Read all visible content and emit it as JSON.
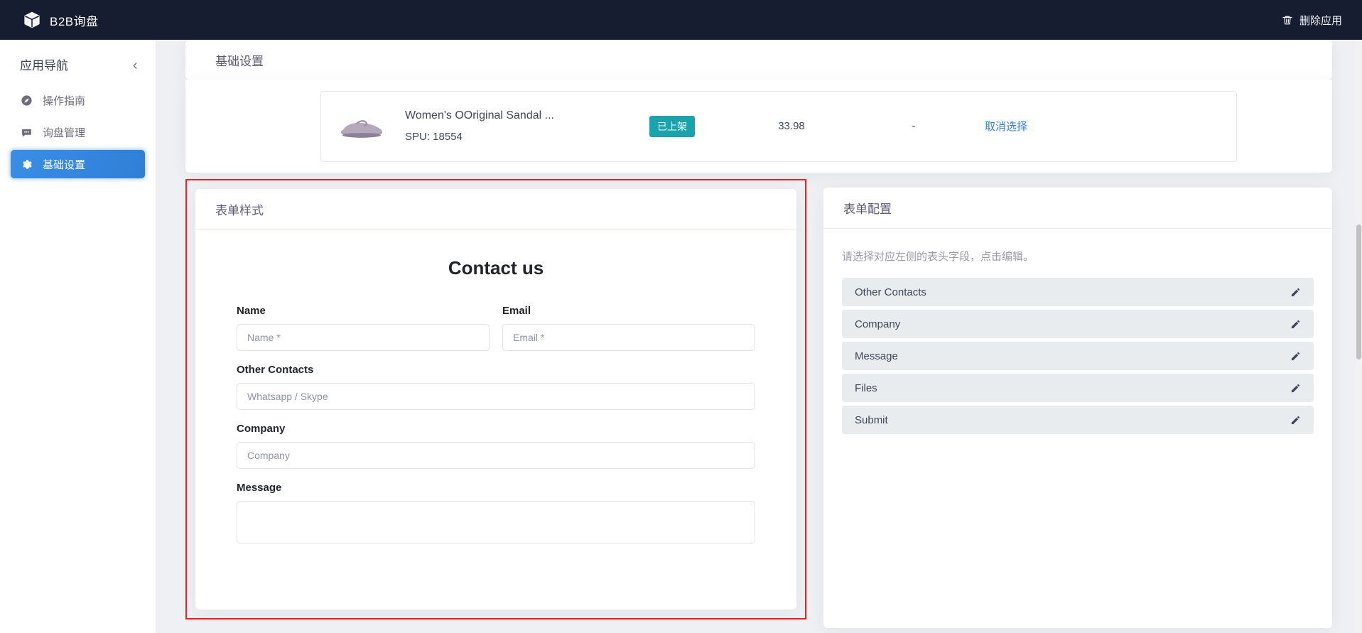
{
  "topbar": {
    "brand_icon": "cube-icon",
    "brand_title": "B2B询盘",
    "delete_icon": "trash-icon",
    "delete_label": "删除应用",
    "bg_color": "#161d31"
  },
  "sidebar": {
    "title": "应用导航",
    "collapse_icon": "chevron-left-icon",
    "active_color": "#3a8ee6",
    "items": [
      {
        "icon": "compass-icon",
        "label": "操作指南",
        "active": false
      },
      {
        "icon": "chat-bubble-icon",
        "label": "询盘管理",
        "active": false
      },
      {
        "icon": "gear-icon",
        "label": "基础设置",
        "active": true
      }
    ]
  },
  "page": {
    "title": "基础设置"
  },
  "product": {
    "thumb_icon": "sandal-image",
    "name": "Women's OOriginal Sandal ...",
    "spu": "SPU: 18554",
    "status_badge": "已上架",
    "status_color": "#1aa3ad",
    "price": "33.98",
    "extra": "-",
    "action_label": "取消选择",
    "action_color": "#2f7fd6"
  },
  "form_style": {
    "card_title": "表单样式",
    "highlight_color": "#fc1c1c",
    "heading": "Contact us",
    "fields": [
      {
        "label": "Name",
        "placeholder": "Name *",
        "type": "input"
      },
      {
        "label": "Email",
        "placeholder": "Email *",
        "type": "input"
      },
      {
        "label": "Other Contacts",
        "placeholder": "Whatsapp / Skype",
        "type": "input"
      },
      {
        "label": "Company",
        "placeholder": "Company",
        "type": "input"
      },
      {
        "label": "Message",
        "placeholder": "",
        "type": "textarea"
      }
    ]
  },
  "form_config": {
    "card_title": "表单配置",
    "hint": "请选择对应左侧的表头字段，点击编辑。",
    "edit_icon": "pencil-icon",
    "items": [
      {
        "label": "Other Contacts"
      },
      {
        "label": "Company"
      },
      {
        "label": "Message"
      },
      {
        "label": "Files"
      },
      {
        "label": "Submit"
      }
    ]
  }
}
